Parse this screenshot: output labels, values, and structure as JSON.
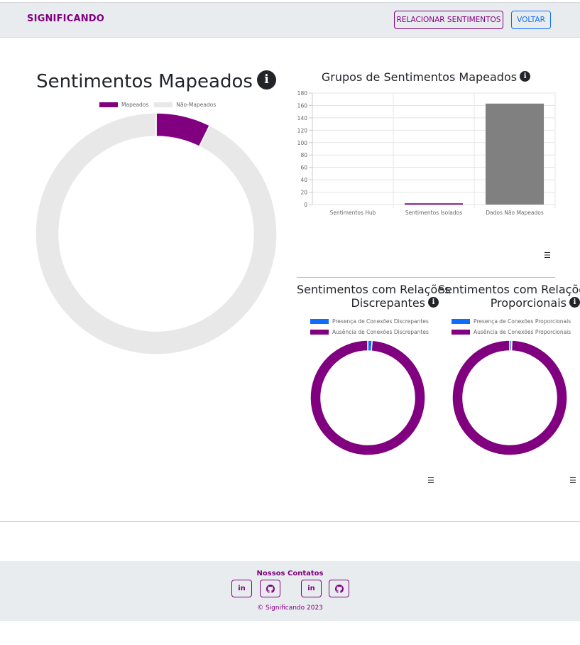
{
  "navbar": {
    "brand": "SIGNIFICANDO",
    "relacionar_label": "RELACIONAR SENTIMENTOS",
    "voltar_label": "VOLTAR"
  },
  "main_chart": {
    "title": "Sentimentos Mapeados",
    "info_icon": "info-circle-icon",
    "legend": [
      "Mapeados",
      "Não-Mapeados"
    ],
    "colors": [
      "#800080",
      "#e8e8e8"
    ]
  },
  "bar_chart": {
    "title": "Grupos de Sentimentos Mapeados",
    "info_icon": "info-circle-icon",
    "list_icon": "list-icon"
  },
  "discrepantes": {
    "title_line1": "Sentimentos com Relações",
    "title_line2": "Discrepantes",
    "legend": [
      "Presença de Conexões Discrepantes",
      "Ausência de Conexões Discrepantes"
    ],
    "colors": [
      "#0d6efd",
      "#800080"
    ],
    "list_icon": "list-icon"
  },
  "proporcionais": {
    "title_line1": "Sentimentos com Relações",
    "title_line2": "Proporcionais",
    "legend": [
      "Presença de Conexões Proporcionais",
      "Ausência de Conexões Proporcionais"
    ],
    "colors": [
      "#0d6efd",
      "#800080"
    ],
    "list_icon": "list-icon"
  },
  "chart_data": [
    {
      "type": "pie",
      "categories": [
        "Mapeados",
        "Não-Mapeados"
      ],
      "values": [
        13,
        165
      ],
      "donut": true,
      "colors": [
        "#800080",
        "#e8e8e8"
      ],
      "legend_position": "top"
    },
    {
      "type": "bar",
      "categories": [
        "Sentimentos Hub",
        "Sentimentos Isolados",
        "Dados Não Mapeados"
      ],
      "values": [
        0,
        2,
        163
      ],
      "bar_colors": [
        "#800080",
        "#800080",
        "#808080"
      ],
      "ylim": [
        0,
        180
      ],
      "yticks": [
        0,
        20,
        40,
        60,
        80,
        100,
        120,
        140,
        160,
        180
      ],
      "grid": true
    },
    {
      "type": "pie",
      "categories": [
        "Presença de Conexões Discrepantes",
        "Ausência de Conexões Discrepantes"
      ],
      "values": [
        2,
        161
      ],
      "donut": true,
      "colors": [
        "#0d6efd",
        "#800080"
      ],
      "legend_position": "top"
    },
    {
      "type": "pie",
      "categories": [
        "Presença de Conexões Proporcionais",
        "Ausência de Conexões Proporcionais"
      ],
      "values": [
        1,
        162
      ],
      "donut": true,
      "colors": [
        "#0d6efd",
        "#800080"
      ],
      "legend_position": "top"
    }
  ],
  "footer": {
    "contacts_title": "Nossos Contatos",
    "social": [
      {
        "icon": "linkedin-icon",
        "glyph": "in"
      },
      {
        "icon": "github-icon",
        "glyph": "gh"
      },
      {
        "icon": "linkedin-icon",
        "glyph": "in"
      },
      {
        "icon": "github-icon",
        "glyph": "gh"
      }
    ],
    "copyright": "© Significando 2023"
  }
}
